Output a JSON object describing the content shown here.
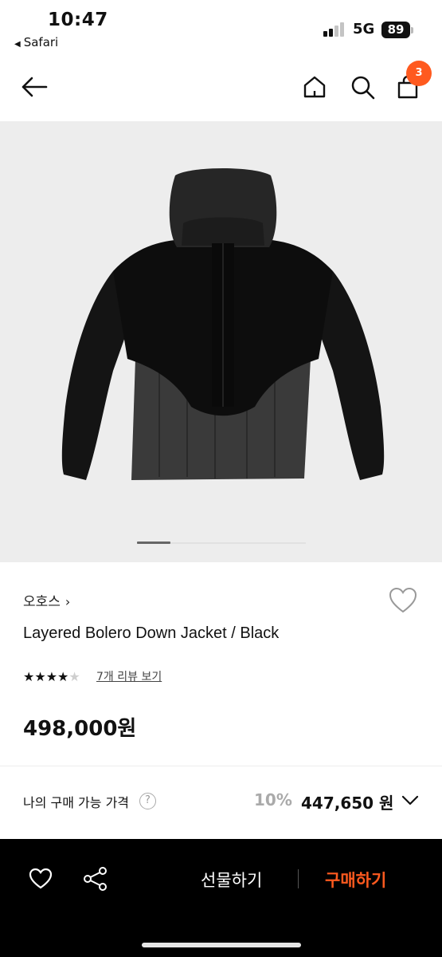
{
  "status_bar": {
    "time": "10:47",
    "back_app": "Safari",
    "network": "5G",
    "battery": "89"
  },
  "header": {
    "icons": [
      "back-arrow-icon",
      "home-icon",
      "search-icon",
      "cart-icon"
    ],
    "cart_count": "3"
  },
  "gallery": {
    "slide_position": 0.2
  },
  "product": {
    "brand": "오호스",
    "brand_chevron": "›",
    "name": "Layered Bolero Down Jacket / Black",
    "rating": 4,
    "rating_max": 5,
    "review_link": "7개 리뷰 보기",
    "price": "498,000원"
  },
  "purchase_price": {
    "label": "나의 구매 가능 가격",
    "help": "?",
    "discount": "10%",
    "final_price": "447,650 원"
  },
  "bottom_bar": {
    "gift_label": "선물하기",
    "buy_label": "구매하기",
    "accent": "#ff5a1f"
  }
}
